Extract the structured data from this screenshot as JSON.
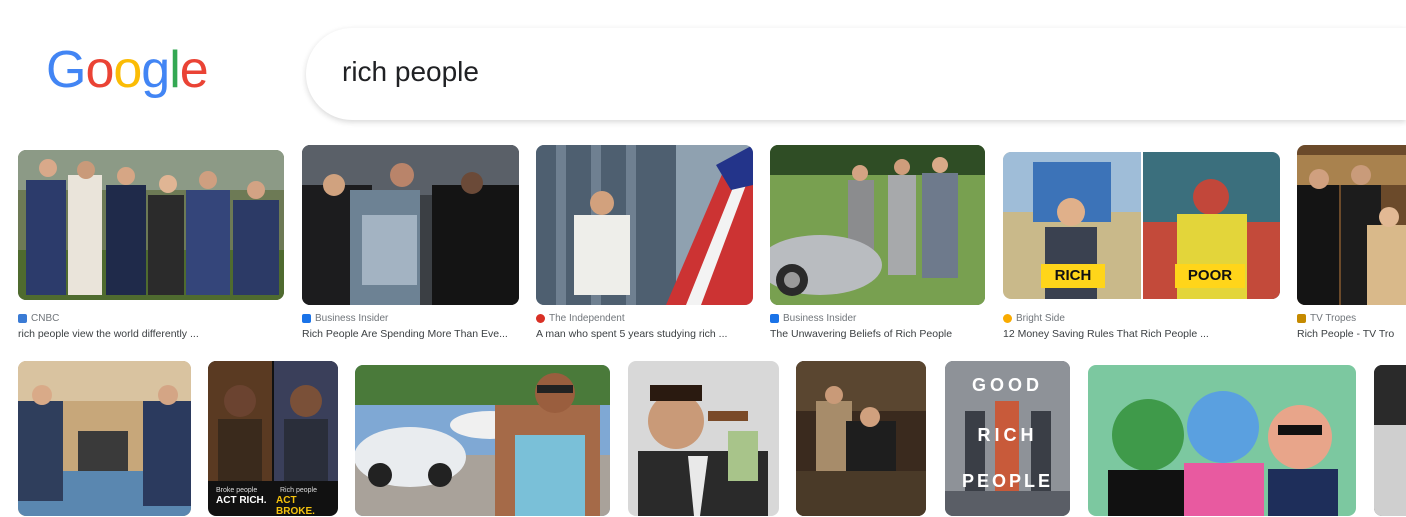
{
  "logo": {
    "text": "Google",
    "letters": [
      "G",
      "o",
      "o",
      "g",
      "l",
      "e"
    ],
    "colors": [
      "#4285f4",
      "#ea4335",
      "#fbbc05",
      "#4285f4",
      "#34a853",
      "#ea4335"
    ]
  },
  "search": {
    "query": "rich people"
  },
  "results_row1": [
    {
      "source": "CNBC",
      "favicon_color": "#3a7bd5",
      "caption": "rich people view the world differently ..."
    },
    {
      "source": "Business Insider",
      "favicon_color": "#1a73e8",
      "caption": "Rich People Are Spending More Than Eve..."
    },
    {
      "source": "The Independent",
      "favicon_color": "#d93025",
      "caption": "A man who spent 5 years studying rich ..."
    },
    {
      "source": "Business Insider",
      "favicon_color": "#1a73e8",
      "caption": "The Unwavering Beliefs of Rich People"
    },
    {
      "source": "Bright Side",
      "favicon_color": "#f9ab00",
      "caption": "12 Money Saving Rules That Rich People ...",
      "labels": [
        "RICH",
        "POOR"
      ]
    },
    {
      "source": "TV Tropes",
      "favicon_color": "#c58a00",
      "caption": "Rich People - TV Tro"
    }
  ],
  "results_row2": [
    {
      "overlay": []
    },
    {
      "overlay": [
        "Broke people",
        "ACT RICH.",
        "Rich people",
        "ACT BROKE."
      ]
    },
    {
      "overlay": []
    },
    {
      "overlay": []
    },
    {
      "overlay": []
    },
    {
      "overlay": [
        "GOOD",
        "RICH",
        "PEOPLE"
      ]
    },
    {
      "overlay": []
    },
    {
      "overlay": []
    }
  ]
}
